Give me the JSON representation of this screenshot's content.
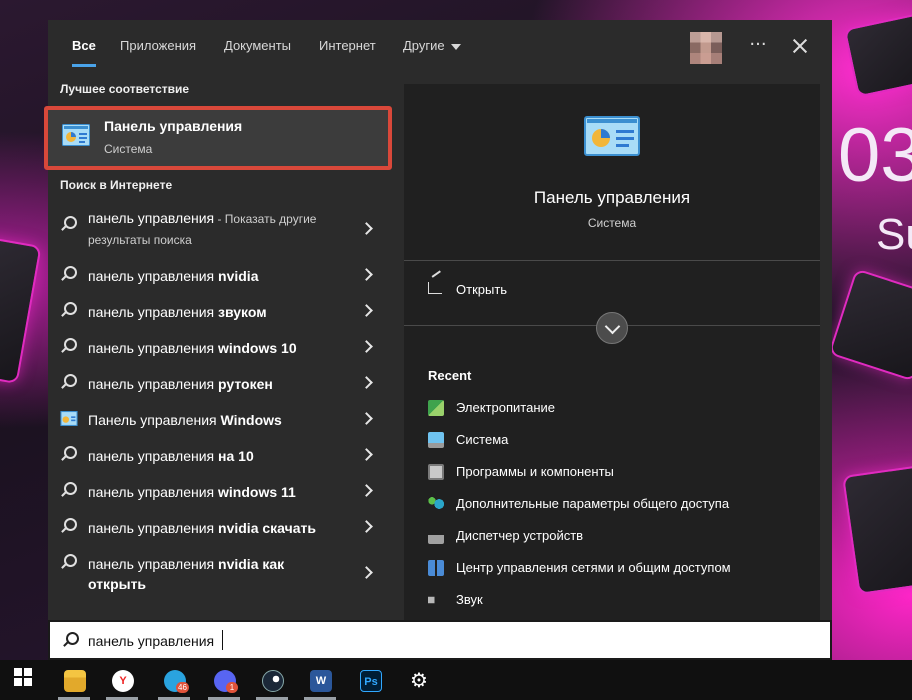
{
  "tabs": [
    {
      "label": "Все",
      "active": true
    },
    {
      "label": "Приложения"
    },
    {
      "label": "Документы"
    },
    {
      "label": "Интернет"
    },
    {
      "label": "Другие"
    }
  ],
  "header": {
    "more_label": "···"
  },
  "best_match": {
    "section_title": "Лучшее соответствие",
    "title": "Панель управления",
    "subtitle": "Система"
  },
  "web": {
    "section_title": "Поиск в Интернете",
    "results": [
      {
        "prefix": "панель управления",
        "bold": "",
        "hint": " - Показать другие результаты поиска",
        "icon": "search-icon"
      },
      {
        "prefix": "панель управления ",
        "bold": "nvidia",
        "hint": "",
        "icon": "search-icon"
      },
      {
        "prefix": "панель управления ",
        "bold": "звуком",
        "hint": "",
        "icon": "search-icon"
      },
      {
        "prefix": "панель управления ",
        "bold": "windows 10",
        "hint": "",
        "icon": "search-icon"
      },
      {
        "prefix": "панель управления ",
        "bold": "рутокен",
        "hint": "",
        "icon": "search-icon"
      },
      {
        "prefix": "Панель управления ",
        "bold": "Windows",
        "hint": "",
        "icon": "control-panel-icon"
      },
      {
        "prefix": "панель управления ",
        "bold": "на 10",
        "hint": "",
        "icon": "search-icon"
      },
      {
        "prefix": "панель управления ",
        "bold": "windows 11",
        "hint": "",
        "icon": "search-icon"
      },
      {
        "prefix": "панель управления ",
        "bold": "nvidia скачать",
        "hint": "",
        "icon": "search-icon"
      },
      {
        "prefix": "панель управления ",
        "bold": "nvidia как открыть",
        "hint": "",
        "icon": "search-icon"
      }
    ]
  },
  "preview": {
    "title": "Панель управления",
    "subtitle": "Система",
    "open_label": "Открыть",
    "recent_title": "Recent",
    "recent": [
      {
        "label": "Электропитание",
        "icon": "power-options-icon",
        "color": "#3fa34d"
      },
      {
        "label": "Система",
        "icon": "system-icon",
        "color": "#3d9ad6"
      },
      {
        "label": "Программы и компоненты",
        "icon": "programs-icon",
        "color": "#c9c9c9"
      },
      {
        "label": "Дополнительные параметры общего доступа",
        "icon": "sharing-icon",
        "color": "#2aa6c9"
      },
      {
        "label": "Диспетчер устройств",
        "icon": "device-manager-icon",
        "color": "#a0a0a0"
      },
      {
        "label": "Центр управления сетями и общим доступом",
        "icon": "network-center-icon",
        "color": "#4a8bd6"
      },
      {
        "label": "Звук",
        "icon": "speaker-icon",
        "color": "#b8b8b8"
      }
    ]
  },
  "search": {
    "value": "панель управления"
  },
  "wallpaper": {
    "text_big": "03",
    "text_small": "Su"
  },
  "taskbar": {
    "items": [
      {
        "name": "file-explorer-icon",
        "color": "#f4c542",
        "text": ""
      },
      {
        "name": "yandex-browser-icon",
        "color": "#ffffff",
        "text": "Y"
      },
      {
        "name": "telegram-icon",
        "color": "#2aa3df",
        "text": "",
        "badge": "46"
      },
      {
        "name": "discord-icon",
        "color": "#5865f2",
        "text": "",
        "badge": "1"
      },
      {
        "name": "steam-icon",
        "color": "#1b2838",
        "text": ""
      },
      {
        "name": "word-icon",
        "color": "#2b579a",
        "text": "W"
      },
      {
        "name": "photoshop-icon",
        "color": "#001e36",
        "text": "Ps"
      },
      {
        "name": "settings-gear-icon",
        "color": "#101010",
        "text": "⚙"
      }
    ]
  },
  "colors": {
    "accent": "#4aa3e9",
    "highlight": "#d9483a",
    "menu_bg": "#2b2b2b",
    "panel_bg": "#202020"
  }
}
